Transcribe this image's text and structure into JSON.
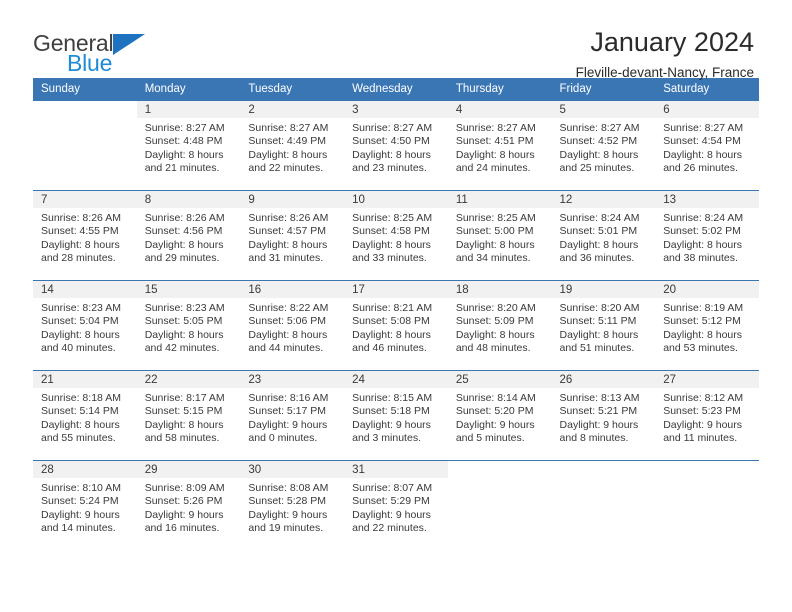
{
  "brand": {
    "name_part1": "General",
    "name_part2": "Blue",
    "triangle_color": "#1f72c0",
    "blue_text_color": "#1f8ad6"
  },
  "header": {
    "title": "January 2024",
    "subtitle": "Fleville-devant-Nancy, France",
    "header_bg_color": "#3b76b4",
    "daynum_bg_color": "#f1f1f1"
  },
  "weekday_headers": [
    "Sunday",
    "Monday",
    "Tuesday",
    "Wednesday",
    "Thursday",
    "Friday",
    "Saturday"
  ],
  "weeks": [
    [
      {
        "day": "",
        "sunrise": "",
        "sunset": "",
        "daylight1": "",
        "daylight2": ""
      },
      {
        "day": "1",
        "sunrise": "Sunrise: 8:27 AM",
        "sunset": "Sunset: 4:48 PM",
        "daylight1": "Daylight: 8 hours",
        "daylight2": "and 21 minutes."
      },
      {
        "day": "2",
        "sunrise": "Sunrise: 8:27 AM",
        "sunset": "Sunset: 4:49 PM",
        "daylight1": "Daylight: 8 hours",
        "daylight2": "and 22 minutes."
      },
      {
        "day": "3",
        "sunrise": "Sunrise: 8:27 AM",
        "sunset": "Sunset: 4:50 PM",
        "daylight1": "Daylight: 8 hours",
        "daylight2": "and 23 minutes."
      },
      {
        "day": "4",
        "sunrise": "Sunrise: 8:27 AM",
        "sunset": "Sunset: 4:51 PM",
        "daylight1": "Daylight: 8 hours",
        "daylight2": "and 24 minutes."
      },
      {
        "day": "5",
        "sunrise": "Sunrise: 8:27 AM",
        "sunset": "Sunset: 4:52 PM",
        "daylight1": "Daylight: 8 hours",
        "daylight2": "and 25 minutes."
      },
      {
        "day": "6",
        "sunrise": "Sunrise: 8:27 AM",
        "sunset": "Sunset: 4:54 PM",
        "daylight1": "Daylight: 8 hours",
        "daylight2": "and 26 minutes."
      }
    ],
    [
      {
        "day": "7",
        "sunrise": "Sunrise: 8:26 AM",
        "sunset": "Sunset: 4:55 PM",
        "daylight1": "Daylight: 8 hours",
        "daylight2": "and 28 minutes."
      },
      {
        "day": "8",
        "sunrise": "Sunrise: 8:26 AM",
        "sunset": "Sunset: 4:56 PM",
        "daylight1": "Daylight: 8 hours",
        "daylight2": "and 29 minutes."
      },
      {
        "day": "9",
        "sunrise": "Sunrise: 8:26 AM",
        "sunset": "Sunset: 4:57 PM",
        "daylight1": "Daylight: 8 hours",
        "daylight2": "and 31 minutes."
      },
      {
        "day": "10",
        "sunrise": "Sunrise: 8:25 AM",
        "sunset": "Sunset: 4:58 PM",
        "daylight1": "Daylight: 8 hours",
        "daylight2": "and 33 minutes."
      },
      {
        "day": "11",
        "sunrise": "Sunrise: 8:25 AM",
        "sunset": "Sunset: 5:00 PM",
        "daylight1": "Daylight: 8 hours",
        "daylight2": "and 34 minutes."
      },
      {
        "day": "12",
        "sunrise": "Sunrise: 8:24 AM",
        "sunset": "Sunset: 5:01 PM",
        "daylight1": "Daylight: 8 hours",
        "daylight2": "and 36 minutes."
      },
      {
        "day": "13",
        "sunrise": "Sunrise: 8:24 AM",
        "sunset": "Sunset: 5:02 PM",
        "daylight1": "Daylight: 8 hours",
        "daylight2": "and 38 minutes."
      }
    ],
    [
      {
        "day": "14",
        "sunrise": "Sunrise: 8:23 AM",
        "sunset": "Sunset: 5:04 PM",
        "daylight1": "Daylight: 8 hours",
        "daylight2": "and 40 minutes."
      },
      {
        "day": "15",
        "sunrise": "Sunrise: 8:23 AM",
        "sunset": "Sunset: 5:05 PM",
        "daylight1": "Daylight: 8 hours",
        "daylight2": "and 42 minutes."
      },
      {
        "day": "16",
        "sunrise": "Sunrise: 8:22 AM",
        "sunset": "Sunset: 5:06 PM",
        "daylight1": "Daylight: 8 hours",
        "daylight2": "and 44 minutes."
      },
      {
        "day": "17",
        "sunrise": "Sunrise: 8:21 AM",
        "sunset": "Sunset: 5:08 PM",
        "daylight1": "Daylight: 8 hours",
        "daylight2": "and 46 minutes."
      },
      {
        "day": "18",
        "sunrise": "Sunrise: 8:20 AM",
        "sunset": "Sunset: 5:09 PM",
        "daylight1": "Daylight: 8 hours",
        "daylight2": "and 48 minutes."
      },
      {
        "day": "19",
        "sunrise": "Sunrise: 8:20 AM",
        "sunset": "Sunset: 5:11 PM",
        "daylight1": "Daylight: 8 hours",
        "daylight2": "and 51 minutes."
      },
      {
        "day": "20",
        "sunrise": "Sunrise: 8:19 AM",
        "sunset": "Sunset: 5:12 PM",
        "daylight1": "Daylight: 8 hours",
        "daylight2": "and 53 minutes."
      }
    ],
    [
      {
        "day": "21",
        "sunrise": "Sunrise: 8:18 AM",
        "sunset": "Sunset: 5:14 PM",
        "daylight1": "Daylight: 8 hours",
        "daylight2": "and 55 minutes."
      },
      {
        "day": "22",
        "sunrise": "Sunrise: 8:17 AM",
        "sunset": "Sunset: 5:15 PM",
        "daylight1": "Daylight: 8 hours",
        "daylight2": "and 58 minutes."
      },
      {
        "day": "23",
        "sunrise": "Sunrise: 8:16 AM",
        "sunset": "Sunset: 5:17 PM",
        "daylight1": "Daylight: 9 hours",
        "daylight2": "and 0 minutes."
      },
      {
        "day": "24",
        "sunrise": "Sunrise: 8:15 AM",
        "sunset": "Sunset: 5:18 PM",
        "daylight1": "Daylight: 9 hours",
        "daylight2": "and 3 minutes."
      },
      {
        "day": "25",
        "sunrise": "Sunrise: 8:14 AM",
        "sunset": "Sunset: 5:20 PM",
        "daylight1": "Daylight: 9 hours",
        "daylight2": "and 5 minutes."
      },
      {
        "day": "26",
        "sunrise": "Sunrise: 8:13 AM",
        "sunset": "Sunset: 5:21 PM",
        "daylight1": "Daylight: 9 hours",
        "daylight2": "and 8 minutes."
      },
      {
        "day": "27",
        "sunrise": "Sunrise: 8:12 AM",
        "sunset": "Sunset: 5:23 PM",
        "daylight1": "Daylight: 9 hours",
        "daylight2": "and 11 minutes."
      }
    ],
    [
      {
        "day": "28",
        "sunrise": "Sunrise: 8:10 AM",
        "sunset": "Sunset: 5:24 PM",
        "daylight1": "Daylight: 9 hours",
        "daylight2": "and 14 minutes."
      },
      {
        "day": "29",
        "sunrise": "Sunrise: 8:09 AM",
        "sunset": "Sunset: 5:26 PM",
        "daylight1": "Daylight: 9 hours",
        "daylight2": "and 16 minutes."
      },
      {
        "day": "30",
        "sunrise": "Sunrise: 8:08 AM",
        "sunset": "Sunset: 5:28 PM",
        "daylight1": "Daylight: 9 hours",
        "daylight2": "and 19 minutes."
      },
      {
        "day": "31",
        "sunrise": "Sunrise: 8:07 AM",
        "sunset": "Sunset: 5:29 PM",
        "daylight1": "Daylight: 9 hours",
        "daylight2": "and 22 minutes."
      },
      {
        "day": "",
        "sunrise": "",
        "sunset": "",
        "daylight1": "",
        "daylight2": ""
      },
      {
        "day": "",
        "sunrise": "",
        "sunset": "",
        "daylight1": "",
        "daylight2": ""
      },
      {
        "day": "",
        "sunrise": "",
        "sunset": "",
        "daylight1": "",
        "daylight2": ""
      }
    ]
  ]
}
